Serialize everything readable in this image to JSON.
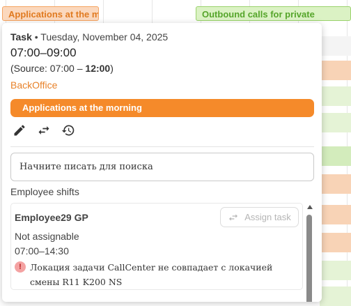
{
  "background": {
    "events": [
      {
        "label": "Applications at the m",
        "color": "#f5a461"
      },
      {
        "label": "Outbound calls for private",
        "color": "#9ad26c"
      }
    ]
  },
  "popup": {
    "header_kind": "Task",
    "header_date": " • Tuesday, November 04, 2025",
    "time_range": "07:00–09:00",
    "source_prefix": "(Source: 07:00 – ",
    "source_end": "12:00",
    "source_suffix": ")",
    "department": "BackOffice",
    "task_name": "Applications at the morning",
    "task_color": "#f58a2a",
    "actions": [
      {
        "icon": "pencil-icon",
        "name": "edit"
      },
      {
        "icon": "swap-icon",
        "name": "reassign"
      },
      {
        "icon": "history-icon",
        "name": "history"
      }
    ],
    "search_placeholder": "Начните писать для поиска",
    "shifts_title": "Employee shifts",
    "shift": {
      "employee": "Employee29 GP",
      "assign_label": "Assign task",
      "status": "Not assignable",
      "time": "07:00–14:30",
      "warning_icon": "!",
      "warning": "Локация задачи CallCenter не совпадает с локачией смены R11 K200 NS"
    }
  }
}
